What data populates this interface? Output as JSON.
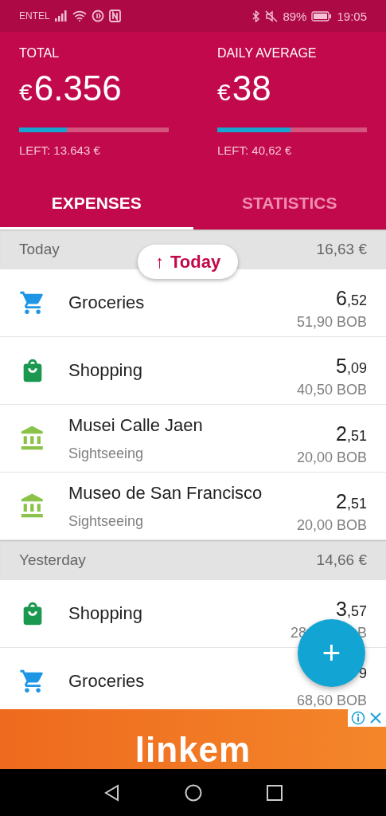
{
  "status_bar": {
    "carrier": "ENTEL",
    "battery": "89%",
    "time": "19:05"
  },
  "summary": [
    {
      "label": "TOTAL",
      "currency": "€",
      "value": "6.356",
      "level": 0.32,
      "left": "LEFT: 13.643 €"
    },
    {
      "label": "DAILY AVERAGE",
      "currency": "€",
      "value": "38",
      "level": 0.49,
      "left": "LEFT: 40,62 €"
    }
  ],
  "tabs": [
    {
      "label": "EXPENSES",
      "selected": true
    },
    {
      "label": "STATISTICS",
      "selected": false
    }
  ],
  "jump_chip": {
    "icon": "↑",
    "label": "Today"
  },
  "groups": [
    {
      "title": "Today",
      "total": "16,63 €",
      "items": [
        {
          "kind": "groceries",
          "title": "Groceries",
          "amount": "6",
          "cents": ",52",
          "foreign": "51,90 BOB"
        },
        {
          "kind": "shopping",
          "title": "Shopping",
          "amount": "5",
          "cents": ",09",
          "foreign": "40,50 BOB"
        },
        {
          "kind": "sightseeing",
          "title": "Musei Calle Jaen",
          "subtitle": "Sightseeing",
          "amount": "2",
          "cents": ",51",
          "foreign": "20,00 BOB"
        },
        {
          "kind": "sightseeing",
          "title": "Museo de San Francisco",
          "subtitle": "Sightseeing",
          "amount": "2",
          "cents": ",51",
          "foreign": "20,00 BOB"
        }
      ]
    },
    {
      "title": "Yesterday",
      "total": "14,66 €",
      "items": [
        {
          "kind": "shopping",
          "title": "Shopping",
          "amount": "3",
          "cents": ",57",
          "foreign_start": "28",
          "foreign_end": "B"
        },
        {
          "kind": "groceries",
          "title": "Groceries",
          "cents": "9",
          "foreign": "68,60 BOB"
        }
      ]
    }
  ],
  "fab": {
    "label": "+"
  },
  "ad": {
    "brand": "linkem"
  }
}
